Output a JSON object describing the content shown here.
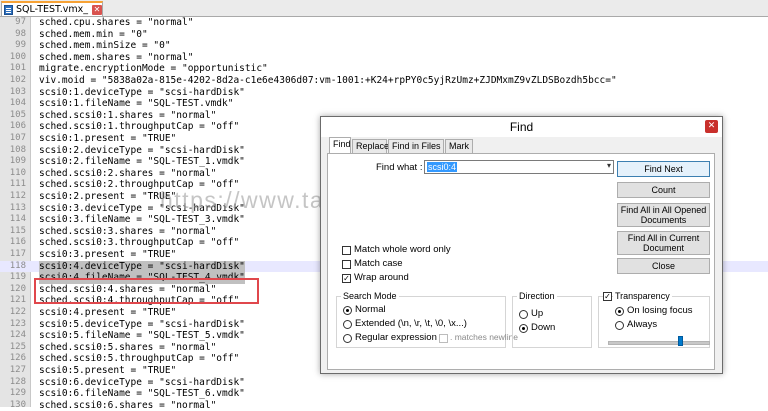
{
  "tab": {
    "title": "SQL-TEST.vmx_",
    "file_icon": "file-icon",
    "close_icon": "close-icon"
  },
  "editor": {
    "lines": [
      {
        "n": "97",
        "text": "sched.cpu.shares = \"normal\""
      },
      {
        "n": "98",
        "text": "sched.mem.min = \"0\""
      },
      {
        "n": "99",
        "text": "sched.mem.minSize = \"0\""
      },
      {
        "n": "100",
        "text": "sched.mem.shares = \"normal\""
      },
      {
        "n": "101",
        "text": "migrate.encryptionMode = \"opportunistic\""
      },
      {
        "n": "102",
        "text": "viv.moid = \"5838a02a-815e-4202-8d2a-c1e6e4306d07:vm-1001:+K24+rpPY0c5yjRzUmz+ZJDMxmZ9vZLDSBozdh5bcc=\""
      },
      {
        "n": "103",
        "text": "scsi0:1.deviceType = \"scsi-hardDisk\""
      },
      {
        "n": "104",
        "text": "scsi0:1.fileName = \"SQL-TEST.vmdk\""
      },
      {
        "n": "105",
        "text": "sched.scsi0:1.shares = \"normal\""
      },
      {
        "n": "106",
        "text": "sched.scsi0:1.throughputCap = \"off\""
      },
      {
        "n": "107",
        "text": "scsi0:1.present = \"TRUE\""
      },
      {
        "n": "108",
        "text": "scsi0:2.deviceType = \"scsi-hardDisk\""
      },
      {
        "n": "109",
        "text": "scsi0:2.fileName = \"SQL-TEST_1.vmdk\""
      },
      {
        "n": "110",
        "text": "sched.scsi0:2.shares = \"normal\""
      },
      {
        "n": "111",
        "text": "sched.scsi0:2.throughputCap = \"off\""
      },
      {
        "n": "112",
        "text": "scsi0:2.present = \"TRUE\""
      },
      {
        "n": "113",
        "text": "scsi0:3.deviceType = \"scsi-hardDisk\""
      },
      {
        "n": "114",
        "text": "scsi0:3.fileName = \"SQL-TEST_3.vmdk\""
      },
      {
        "n": "115",
        "text": "sched.scsi0:3.shares = \"normal\""
      },
      {
        "n": "116",
        "text": "sched.scsi0:3.throughputCap = \"off\""
      },
      {
        "n": "117",
        "text": "scsi0:3.present = \"TRUE\""
      },
      {
        "n": "118",
        "text": "scsi0:4.deviceType = \"scsi-hardDisk\""
      },
      {
        "n": "119",
        "text": "scsi0:4.fileName = \"SQL-TEST_4.vmdk\""
      },
      {
        "n": "120",
        "text": "sched.scsi0:4.shares = \"normal\""
      },
      {
        "n": "121",
        "text": "sched.scsi0:4.throughputCap = \"off\""
      },
      {
        "n": "122",
        "text": "scsi0:4.present = \"TRUE\""
      },
      {
        "n": "123",
        "text": "scsi0:5.deviceType = \"scsi-hardDisk\""
      },
      {
        "n": "124",
        "text": "scsi0:5.fileName = \"SQL-TEST_5.vmdk\""
      },
      {
        "n": "125",
        "text": "sched.scsi0:5.shares = \"normal\""
      },
      {
        "n": "126",
        "text": "sched.scsi0:5.throughputCap = \"off\""
      },
      {
        "n": "127",
        "text": "scsi0:5.present = \"TRUE\""
      },
      {
        "n": "128",
        "text": "scsi0:6.deviceType = \"scsi-hardDisk\""
      },
      {
        "n": "129",
        "text": "scsi0:6.fileName = \"SQL-TEST_6.vmdk\""
      },
      {
        "n": "130",
        "text": "sched.scsi0:6.shares = \"normal\""
      }
    ],
    "selected_line_numbers": [
      "118",
      "119"
    ],
    "current_line_number": "118"
  },
  "watermark": "https://www.tayfundeger.com",
  "find_dialog": {
    "title": "Find",
    "tabs": [
      "Find",
      "Replace",
      "Find in Files",
      "Mark"
    ],
    "active_tab": "Find",
    "find_what_label": "Find what :",
    "find_what_value": "scsi0:4",
    "buttons": {
      "find_next": "Find Next",
      "count": "Count",
      "find_all_opened": "Find All in All Opened Documents",
      "find_all_current": "Find All in Current Document",
      "close": "Close"
    },
    "options": {
      "match_whole_word": {
        "label": "Match whole word only",
        "checked": false
      },
      "match_case": {
        "label": "Match case",
        "checked": false
      },
      "wrap_around": {
        "label": "Wrap around",
        "checked": true
      }
    },
    "search_mode": {
      "label": "Search Mode",
      "normal": "Normal",
      "extended": "Extended (\\n, \\r, \\t, \\0, \\x...)",
      "regex": "Regular expression",
      "matches_newline": ". matches newline",
      "selected": "Normal"
    },
    "direction": {
      "label": "Direction",
      "up": "Up",
      "down": "Down",
      "selected": "Down"
    },
    "transparency": {
      "label": "Transparency",
      "checked": true,
      "on_losing_focus": "On losing focus",
      "always": "Always",
      "selected": "On losing focus",
      "level_fraction": 0.72
    },
    "colors": {
      "highlight_box": "#e0474c",
      "selection": "#3399ff"
    }
  }
}
